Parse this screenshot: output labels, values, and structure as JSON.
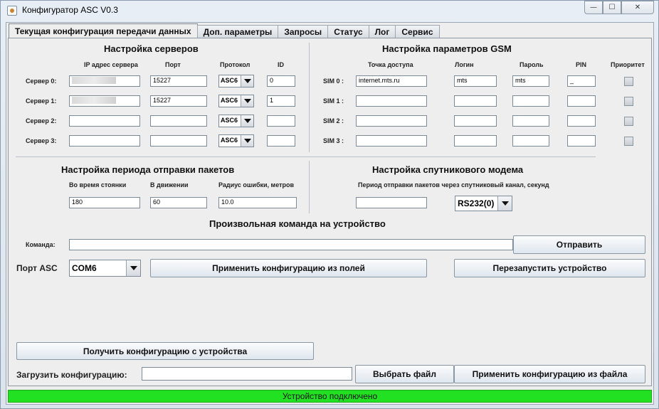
{
  "window": {
    "title": "Конфигуратор ASC V0.3"
  },
  "tabs": [
    "Текущая конфигурация передачи данных",
    "Доп. параметры",
    "Запросы",
    "Статус",
    "Лог",
    "Сервис"
  ],
  "servers": {
    "heading": "Настройка серверов",
    "col_ip": "IP адрес сервера",
    "col_port": "Порт",
    "col_proto": "Протокол",
    "col_id": "ID",
    "rows": [
      {
        "label": "Сервер 0:",
        "ip": "",
        "port": "15227",
        "proto": "ASC6",
        "id": "0"
      },
      {
        "label": "Сервер 1:",
        "ip": "",
        "port": "15227",
        "proto": "ASC6",
        "id": "1"
      },
      {
        "label": "Сервер 2:",
        "ip": "",
        "port": "",
        "proto": "ASC6",
        "id": ""
      },
      {
        "label": "Сервер 3:",
        "ip": "",
        "port": "",
        "proto": "ASC6",
        "id": ""
      }
    ]
  },
  "gsm": {
    "heading": "Настройка параметров GSM",
    "col_apn": "Точка доступа",
    "col_login": "Логин",
    "col_pass": "Пароль",
    "col_pin": "PIN",
    "col_prio": "Приоритет",
    "rows": [
      {
        "label": "SIM 0 :",
        "apn": "internet.mts.ru",
        "login": "mts",
        "pass": "mts",
        "pin": "_"
      },
      {
        "label": "SIM 1 :",
        "apn": "",
        "login": "",
        "pass": "",
        "pin": ""
      },
      {
        "label": "SIM 2 :",
        "apn": "",
        "login": "",
        "pass": "",
        "pin": ""
      },
      {
        "label": "SIM 3 :",
        "apn": "",
        "login": "",
        "pass": "",
        "pin": ""
      }
    ]
  },
  "period": {
    "heading": "Настройка периода отправки пакетов",
    "col_park": "Во время стоянки",
    "col_move": "В движении",
    "col_radius": "Радиус ошибки, метров",
    "park": "180",
    "move": "60",
    "radius": "10.0"
  },
  "satellite": {
    "heading": "Настройка спутникового модема",
    "label": "Период отправки пакетов через спутниковый канал, секунд",
    "value": "",
    "port": "RS232(0)"
  },
  "command": {
    "heading": "Произвольная команда на устройство",
    "label": "Команда:",
    "value": "",
    "send": "Отправить"
  },
  "port": {
    "label": "Порт ASC",
    "value": "COM6",
    "apply_fields": "Применить конфигурацию из полей",
    "restart": "Перезапустить устройство"
  },
  "get_config": "Получить конфигурацию с устройства",
  "load": {
    "label": "Загрузить конфигурацию:",
    "value": "",
    "choose": "Выбрать файл",
    "apply_file": "Применить конфигурацию из файла"
  },
  "status": "Устройство подключено"
}
